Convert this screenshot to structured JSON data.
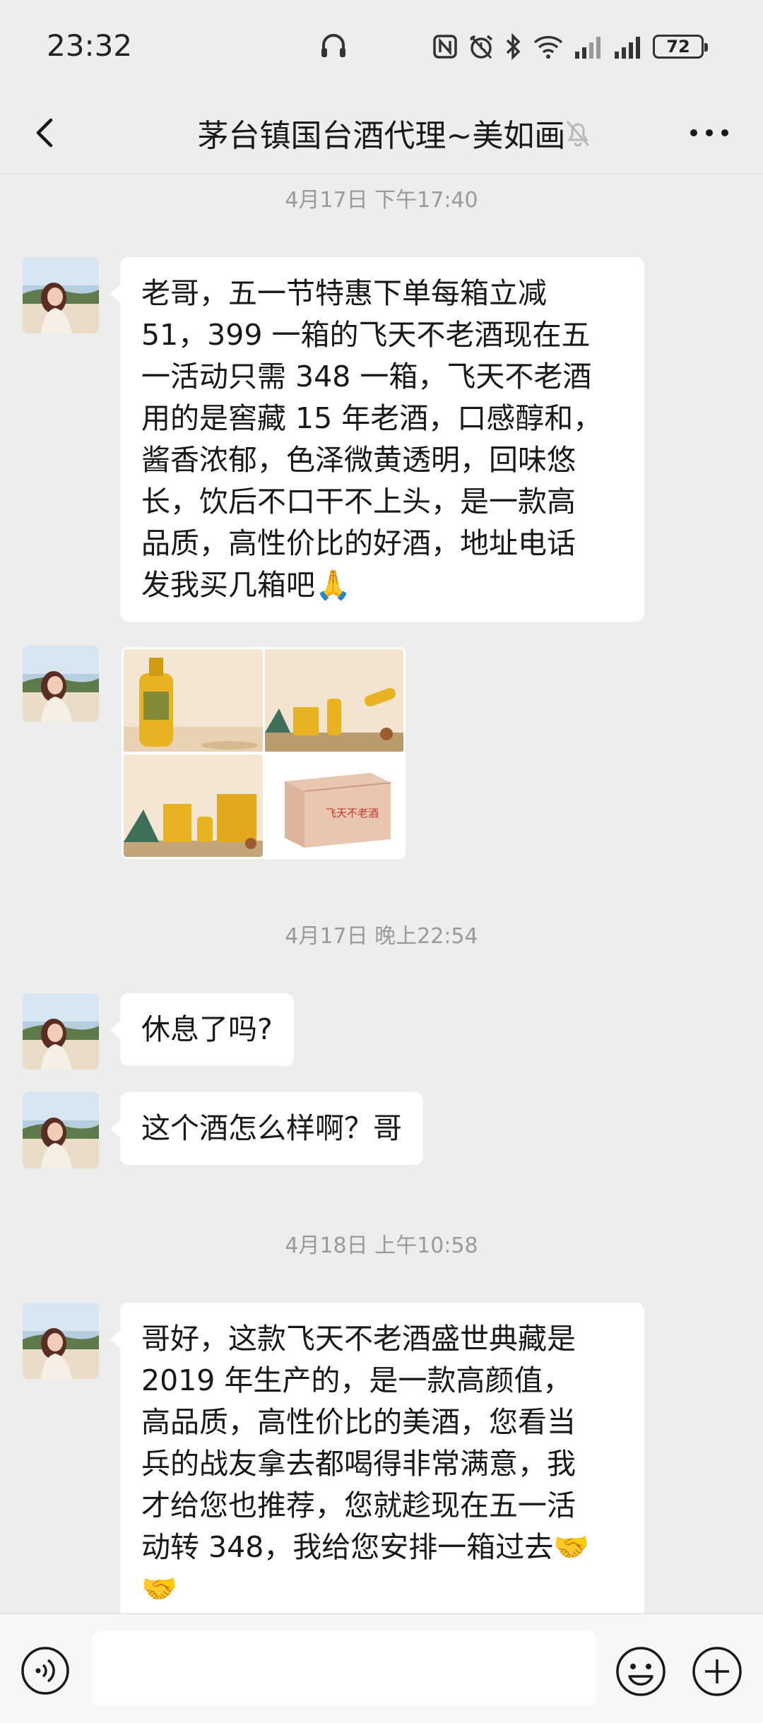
{
  "status_bar": {
    "time": "23:32",
    "battery": "72",
    "icons": [
      "headphone-icon",
      "nfc-icon",
      "alarm-icon",
      "bluetooth-icon",
      "wifi-icon",
      "signal-icon",
      "signal-icon",
      "battery-icon"
    ]
  },
  "header": {
    "title": "茅台镇国台酒代理~美如画",
    "back_icon": "chevron-left-icon",
    "mute_icon": "bell-muted-icon",
    "more_icon": "ellipsis-icon"
  },
  "messages": {
    "ts1": "4月17日 下午17:40",
    "msg1": "老哥，五一节特惠下单每箱立减\n51，399 一箱的飞天不老酒现在五\n一活动只需 348 一箱，飞天不老酒\n用的是窖藏 15 年老酒，口感醇和，\n酱香浓郁，色泽微黄透明，回味悠\n长，饮后不口干不上头，是一款高\n品质，高性价比的好酒，地址电话\n发我买几箱吧🙏",
    "images": {
      "box_label": "飞天不老酒"
    },
    "ts2": "4月17日 晚上22:54",
    "msg2": "休息了吗?",
    "msg3": "这个酒怎么样啊？哥",
    "ts3": "4月18日 上午10:58",
    "msg4": "哥好，这款飞天不老酒盛世典藏是\n2019 年生产的，是一款高颜值，\n高品质，高性价比的美酒，您看当\n兵的战友拿去都喝得非常满意，我\n才给您也推荐，您就趁现在五一活\n动转 348，我给您安排一箱过去🤝\n🤝"
  },
  "input_bar": {
    "voice_icon": "voice-icon",
    "emoji_icon": "emoji-icon",
    "plus_icon": "plus-icon"
  },
  "colors": {
    "background": "#ededed",
    "bubble": "#ffffff",
    "timestamp": "#9a9a9a",
    "bottle_yellow": "#e8b323"
  }
}
